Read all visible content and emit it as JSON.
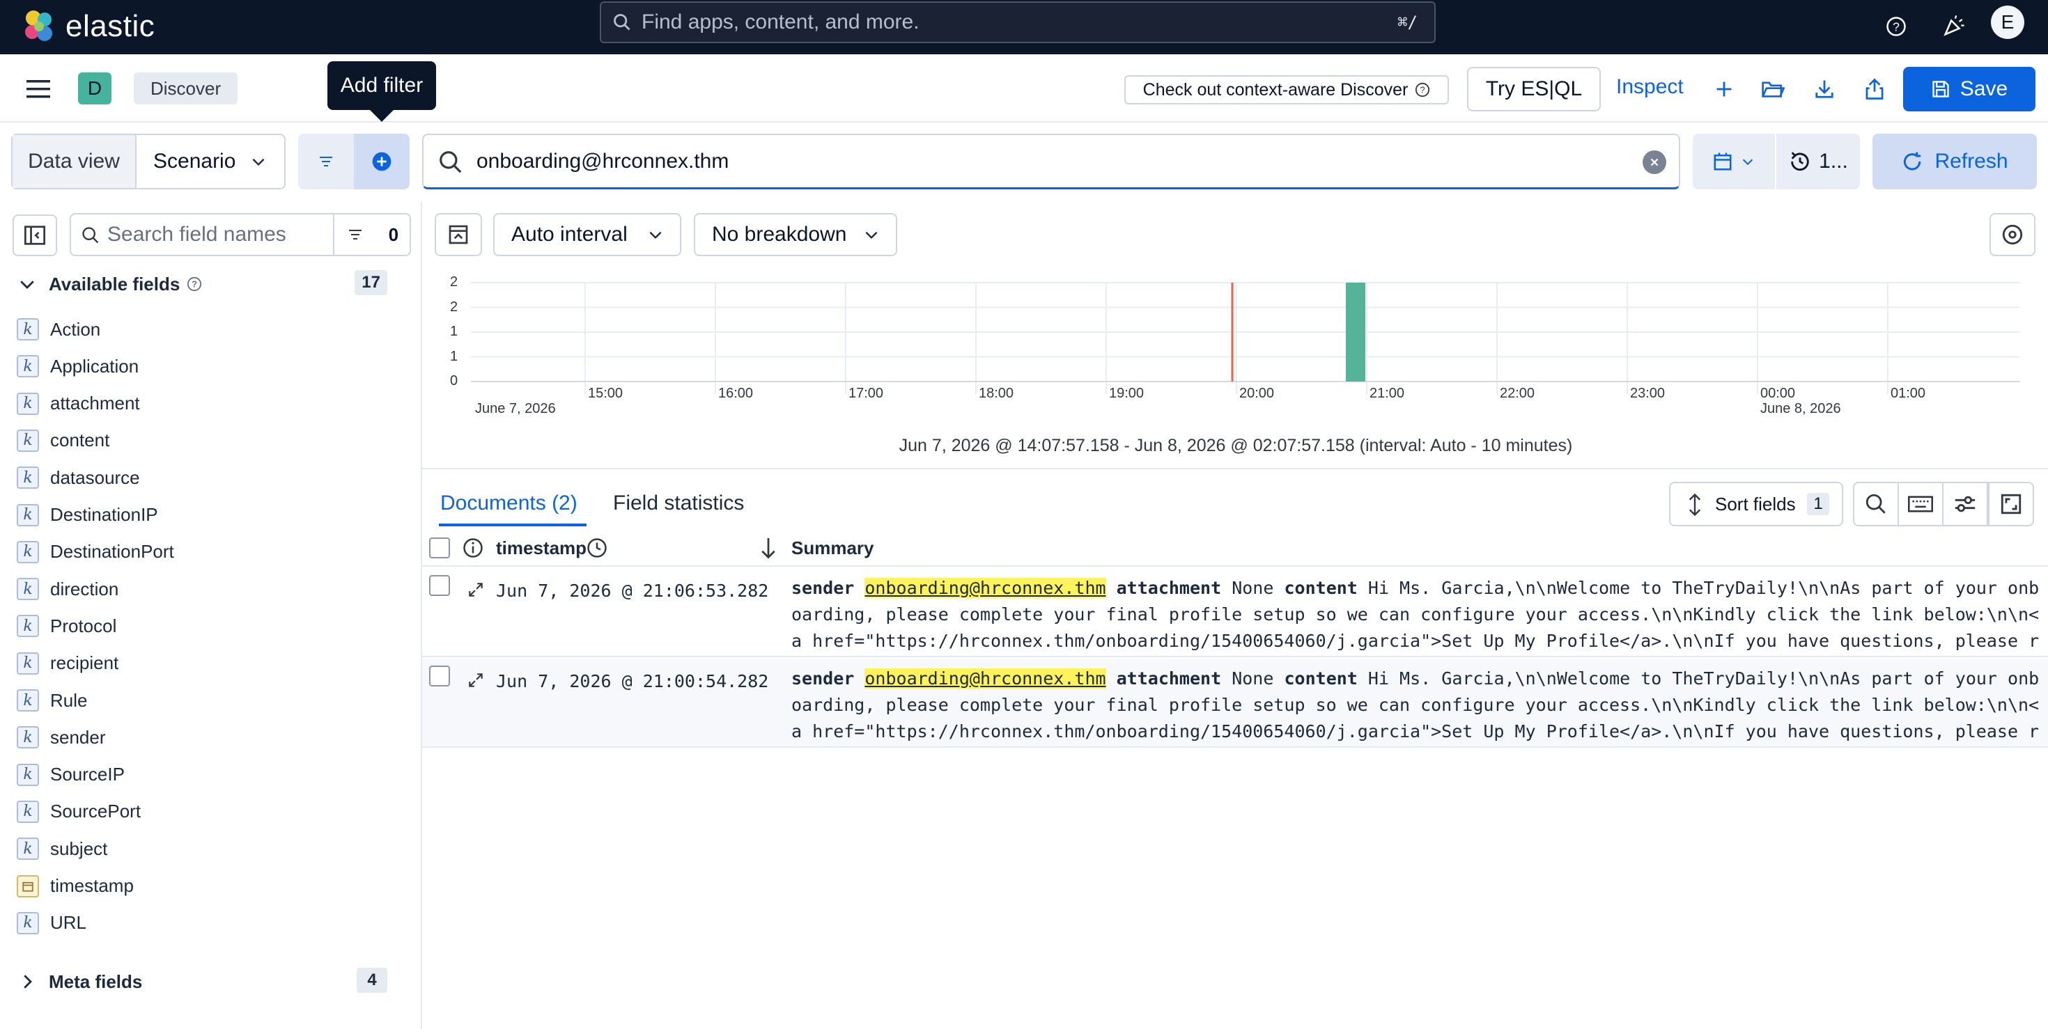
{
  "header": {
    "brand": "elastic",
    "search_placeholder": "Find apps, content, and more.",
    "search_shortcut": "⌘/",
    "avatar_initial": "E"
  },
  "nav": {
    "space_initial": "D",
    "breadcrumb": "Discover",
    "tooltip": "Add filter",
    "context_button": "Check out context-aware Discover",
    "esql_button": "Try ES|QL",
    "inspect": "Inspect",
    "save": "Save"
  },
  "query": {
    "dataview_label": "Data view",
    "dataview_value": "Scenario",
    "text": "onboarding@hrconnex.thm",
    "refresh_interval": "1...",
    "refresh_label": "Refresh"
  },
  "sidebar": {
    "search_placeholder": "Search field names",
    "filter_count": "0",
    "available_label": "Available fields",
    "available_count": "17",
    "fields": [
      {
        "name": "Action",
        "type": "k"
      },
      {
        "name": "Application",
        "type": "k"
      },
      {
        "name": "attachment",
        "type": "k"
      },
      {
        "name": "content",
        "type": "k"
      },
      {
        "name": "datasource",
        "type": "k"
      },
      {
        "name": "DestinationIP",
        "type": "k"
      },
      {
        "name": "DestinationPort",
        "type": "k"
      },
      {
        "name": "direction",
        "type": "k"
      },
      {
        "name": "Protocol",
        "type": "k"
      },
      {
        "name": "recipient",
        "type": "k"
      },
      {
        "name": "Rule",
        "type": "k"
      },
      {
        "name": "sender",
        "type": "k"
      },
      {
        "name": "SourceIP",
        "type": "k"
      },
      {
        "name": "SourcePort",
        "type": "k"
      },
      {
        "name": "subject",
        "type": "k"
      },
      {
        "name": "timestamp",
        "type": "date"
      },
      {
        "name": "URL",
        "type": "k"
      }
    ],
    "meta_label": "Meta fields",
    "meta_count": "4"
  },
  "histogram": {
    "interval_label": "Auto interval",
    "breakdown_label": "No breakdown",
    "y_ticks": [
      "2",
      "2",
      "1",
      "1",
      "0"
    ],
    "x_ticks": [
      "15:00",
      "16:00",
      "17:00",
      "18:00",
      "19:00",
      "20:00",
      "21:00",
      "22:00",
      "23:00",
      "00:00",
      "01:00"
    ],
    "date_start": "June 7, 2026",
    "date_next": "June 8, 2026",
    "range_text": "Jun 7, 2026 @ 14:07:57.158 - Jun 8, 2026 @ 02:07:57.158 (interval: Auto - 10 minutes)",
    "bar_color": "#54b399",
    "now_marker_color": "#e7664c"
  },
  "chart_data": {
    "type": "bar",
    "x_ticks": [
      "15:00",
      "16:00",
      "17:00",
      "18:00",
      "19:00",
      "20:00",
      "21:00",
      "22:00",
      "23:00",
      "00:00",
      "01:00"
    ],
    "bars": [
      {
        "x": "21:00",
        "value": 2
      }
    ],
    "ylim": [
      0,
      2
    ]
  },
  "tabs": {
    "documents": "Documents (2)",
    "field_stats": "Field statistics",
    "sort_fields": "Sort fields",
    "sort_count": "1"
  },
  "grid": {
    "col_timestamp": "timestamp",
    "col_summary": "Summary",
    "rows": [
      {
        "timestamp": "Jun 7, 2026 @ 21:06:53.282",
        "sender_key": "sender",
        "sender": "onboarding@hrconnex.thm",
        "attachment_key": "attachment",
        "attachment": "None",
        "content_key": "content",
        "content": "Hi Ms. Garcia,\\n\\nWelcome to TheTryDaily!\\n\\nAs part of your onboarding, please complete your final profile setup so we can configure your access.\\n\\nKindly click the link below:\\n\\n<a href=\"https://hrconnex.thm/onboarding/15400654060/j.garcia\">Set Up My Profile</a>.\\n\\nIf you have questions, please reach out to th…"
      },
      {
        "timestamp": "Jun 7, 2026 @ 21:00:54.282",
        "sender_key": "sender",
        "sender": "onboarding@hrconnex.thm",
        "attachment_key": "attachment",
        "attachment": "None",
        "content_key": "content",
        "content": "Hi Ms. Garcia,\\n\\nWelcome to TheTryDaily!\\n\\nAs part of your onboarding, please complete your final profile setup so we can configure your access.\\n\\nKindly click the link below:\\n\\n<a href=\"https://hrconnex.thm/onboarding/15400654060/j.garcia\">Set Up My Profile</a>.\\n\\nIf you have questions, please reach out to th…"
      }
    ]
  }
}
